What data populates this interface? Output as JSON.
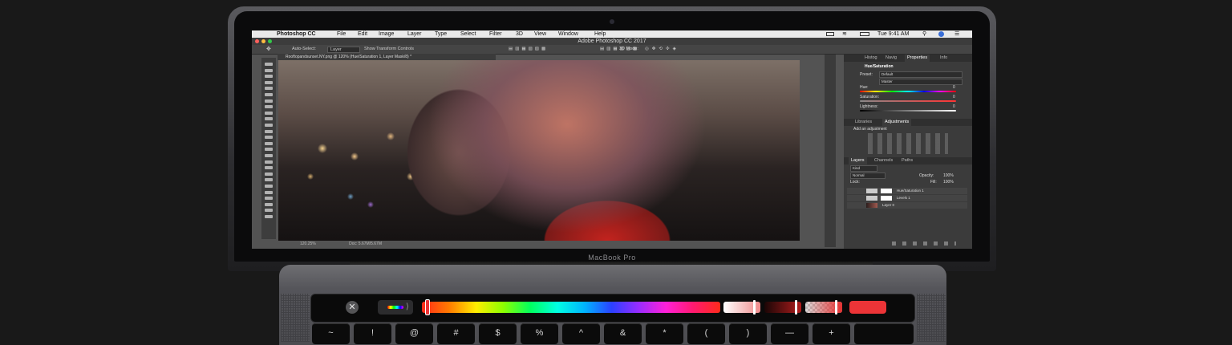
{
  "laptop": {
    "label": "MacBook Pro"
  },
  "mac_menubar": {
    "app_name": "Photoshop CC",
    "menus": [
      "File",
      "Edit",
      "Image",
      "Layer",
      "Type",
      "Select",
      "Filter",
      "3D",
      "View",
      "Window",
      "Help"
    ],
    "clock": "Tue 9:41 AM"
  },
  "window": {
    "title": "Adobe Photoshop CC 2017"
  },
  "options_bar": {
    "auto_select_label": "Auto-Select:",
    "auto_select_value": "Layer",
    "transform_label": "Show Transform Controls",
    "mode_3d": "3D Mode:"
  },
  "document": {
    "tab": "Rooftopandsunset.NY.png @ 120% (Hue/Saturation 1, Layer Mask/8) *",
    "zoom": "120.25%",
    "doc_size": "Doc: 5.67M/5.67M"
  },
  "panels": {
    "top_tabs": [
      "Histog",
      "Navig",
      "Properties",
      "Info"
    ],
    "properties": {
      "title": "Hue/Saturation",
      "preset_label": "Preset:",
      "preset_value": "Default",
      "channel_value": "Master",
      "hue_label": "Hue:",
      "hue_value": "0",
      "saturation_label": "Saturation:",
      "saturation_value": "0",
      "lightness_label": "Lightness:",
      "lightness_value": "0"
    },
    "mid_tabs": [
      "Libraries",
      "Adjustments"
    ],
    "adjustments": {
      "add_label": "Add an adjustment"
    },
    "layers_tabs": [
      "Layers",
      "Channels",
      "Paths"
    ],
    "layers": {
      "kind_filter": "Kind",
      "blend_mode": "Normal",
      "opacity_label": "Opacity:",
      "opacity_value": "100%",
      "lock_label": "Lock:",
      "fill_label": "Fill:",
      "fill_value": "100%",
      "items": [
        "Hue/Saturation 1",
        "Levels 1",
        "Layer 0"
      ]
    }
  },
  "touch_bar": {
    "close_glyph": "✕",
    "arrow_glyph": "⟩",
    "spectrum_colors": [
      "#ff2a1a",
      "#ffee00",
      "#00ff5e",
      "#00ffe4",
      "#2b40ff",
      "#ff20d8"
    ],
    "selected_color": "#ec3437",
    "spectrum_position": 0.01
  },
  "keys": [
    "~",
    "!",
    "@",
    "#",
    "$",
    "%",
    "^",
    "&",
    "*",
    "(",
    ")",
    "—",
    "+",
    ""
  ]
}
